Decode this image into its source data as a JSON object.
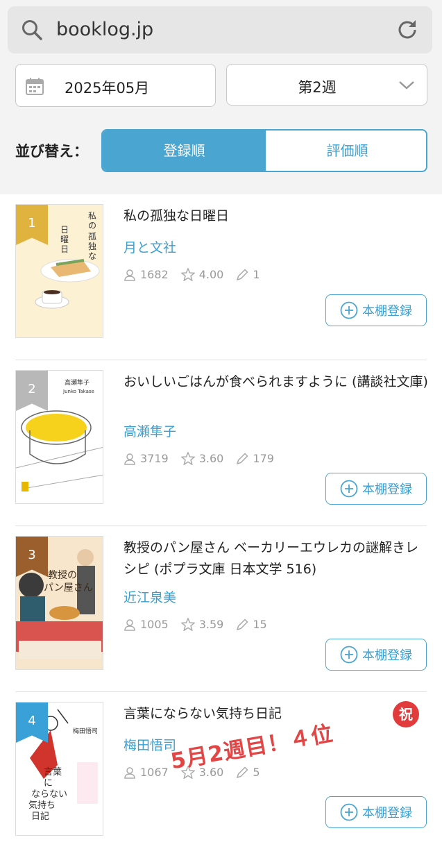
{
  "browser": {
    "url": "booklog.jp"
  },
  "filters": {
    "month": "2025年05月",
    "week": "第2週",
    "sort_label": "並び替え：",
    "sort_options": [
      "登録順",
      "評価順"
    ],
    "sort_selected": "登録順"
  },
  "colors": {
    "accent": "#4aa6d0",
    "link": "#3b9fd0",
    "rank1": "#e0b23e",
    "rank2": "#b8b8b8",
    "rank3": "#9a5f2c",
    "rank4": "#3aa0d8",
    "overlay": "#e24545"
  },
  "register_label": "本棚登録",
  "books": [
    {
      "rank": "1",
      "title": "私の孤独な日曜日",
      "author": "月と文社",
      "readers": "1682",
      "rating": "4.00",
      "reviews": "1",
      "cover_text": "私の孤独な日曜日"
    },
    {
      "rank": "2",
      "title": "おいしいごはんが食べられますように (講談社文庫)",
      "author": "高瀬隼子",
      "readers": "3719",
      "rating": "3.60",
      "reviews": "179",
      "cover_text": "高瀬隼子"
    },
    {
      "rank": "3",
      "title": "教授のパン屋さん ベーカリーエウレカの謎解きレシピ (ポプラ文庫 日本文学 516)",
      "author": "近江泉美",
      "readers": "1005",
      "rating": "3.59",
      "reviews": "15",
      "cover_text": "教授のパン屋さん"
    },
    {
      "rank": "4",
      "title": "言葉にならない気持ち日記",
      "author": "梅田悟司",
      "readers": "1067",
      "rating": "3.60",
      "reviews": "5",
      "cover_text": "言葉にならない気持ち日記"
    }
  ],
  "annotation": {
    "text": "5月2週目！４位",
    "badge": "祝"
  }
}
